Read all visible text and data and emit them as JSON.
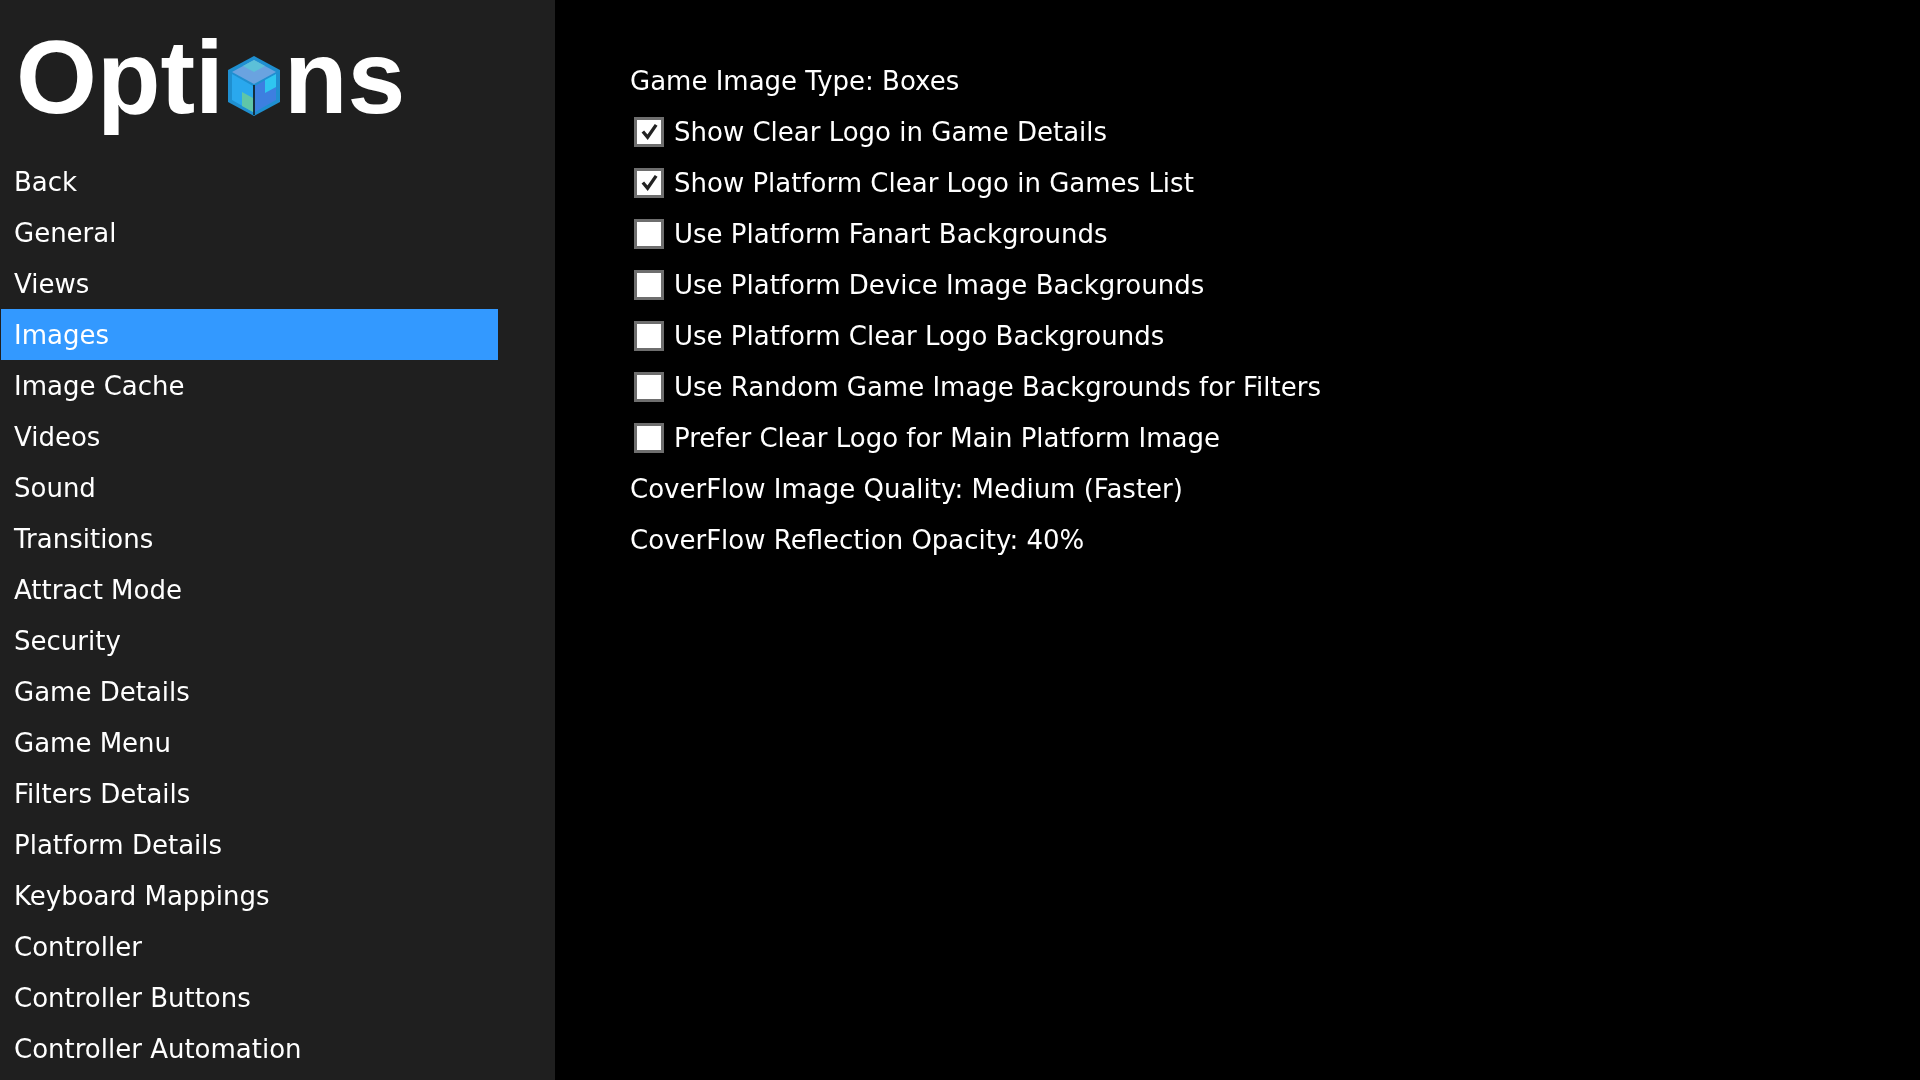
{
  "sidebar": {
    "title": [
      "Opti",
      "ns"
    ],
    "items": [
      {
        "label": "Back",
        "selected": false
      },
      {
        "label": "General",
        "selected": false
      },
      {
        "label": "Views",
        "selected": false
      },
      {
        "label": "Images",
        "selected": true
      },
      {
        "label": "Image Cache",
        "selected": false
      },
      {
        "label": "Videos",
        "selected": false
      },
      {
        "label": "Sound",
        "selected": false
      },
      {
        "label": "Transitions",
        "selected": false
      },
      {
        "label": "Attract Mode",
        "selected": false
      },
      {
        "label": "Security",
        "selected": false
      },
      {
        "label": "Game Details",
        "selected": false
      },
      {
        "label": "Game Menu",
        "selected": false
      },
      {
        "label": "Filters Details",
        "selected": false
      },
      {
        "label": "Platform Details",
        "selected": false
      },
      {
        "label": "Keyboard Mappings",
        "selected": false
      },
      {
        "label": "Controller",
        "selected": false
      },
      {
        "label": "Controller Buttons",
        "selected": false
      },
      {
        "label": "Controller Automation",
        "selected": false
      }
    ]
  },
  "settings": [
    {
      "kind": "choice",
      "label": "Game Image Type: Boxes"
    },
    {
      "kind": "checkbox",
      "label": "Show Clear Logo in Game Details",
      "checked": true
    },
    {
      "kind": "checkbox",
      "label": "Show Platform Clear Logo in Games List",
      "checked": true
    },
    {
      "kind": "checkbox",
      "label": "Use Platform Fanart Backgrounds",
      "checked": false
    },
    {
      "kind": "checkbox",
      "label": "Use Platform Device Image Backgrounds",
      "checked": false
    },
    {
      "kind": "checkbox",
      "label": "Use Platform Clear Logo Backgrounds",
      "checked": false
    },
    {
      "kind": "checkbox",
      "label": "Use Random Game Image Backgrounds for Filters",
      "checked": false
    },
    {
      "kind": "checkbox",
      "label": "Prefer Clear Logo for Main Platform Image",
      "checked": false
    },
    {
      "kind": "choice",
      "label": "CoverFlow Image Quality: Medium (Faster)"
    },
    {
      "kind": "choice",
      "label": "CoverFlow Reflection Opacity: 40%"
    }
  ]
}
